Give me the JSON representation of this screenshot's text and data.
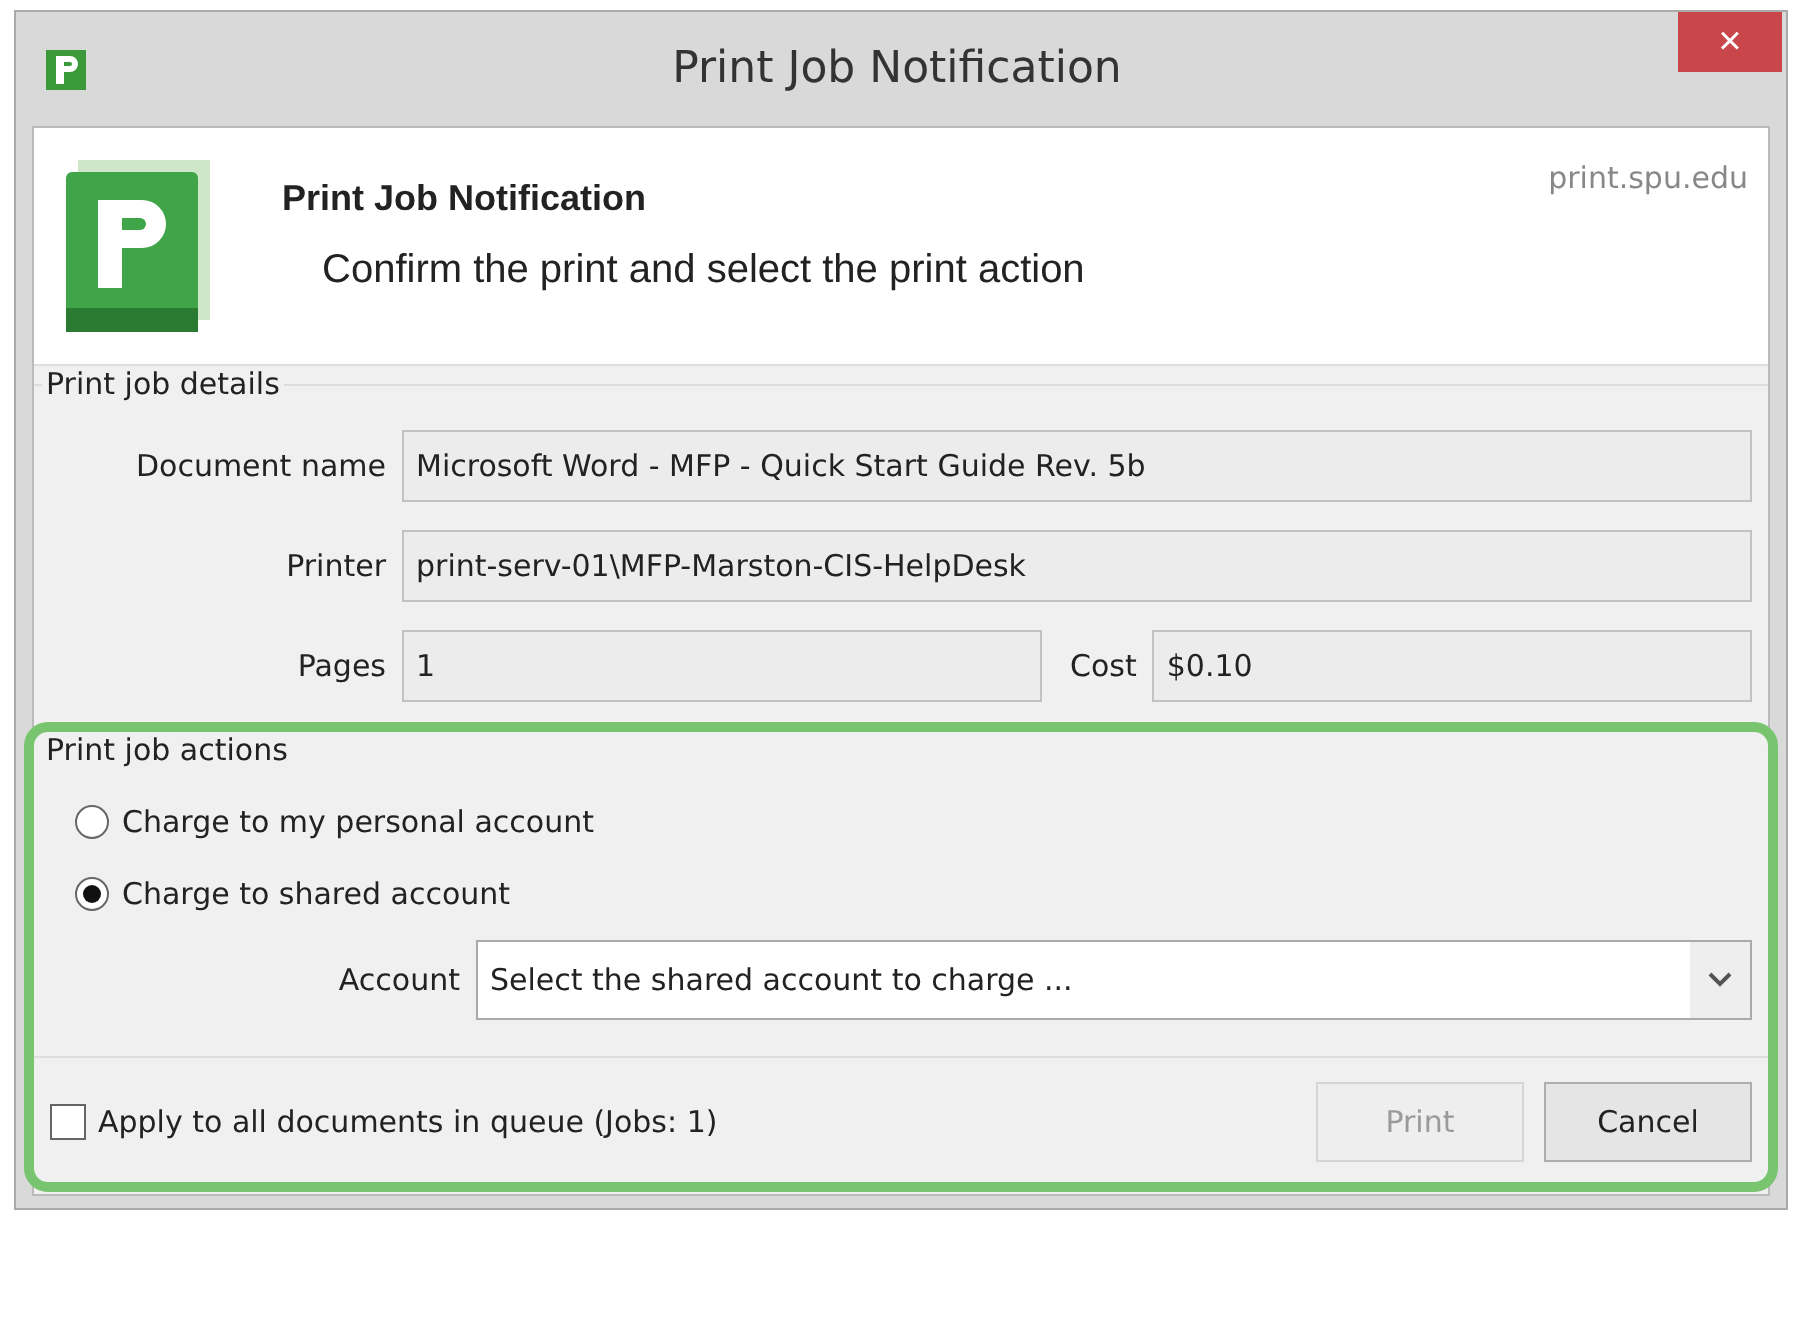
{
  "window": {
    "title": "Print Job Notification",
    "close": "×"
  },
  "header": {
    "title": "Print Job Notification",
    "subtitle": "Confirm the print and select the print action",
    "server": "print.spu.edu"
  },
  "details": {
    "legend": "Print job details",
    "fields": [
      {
        "label": "Document name",
        "value": "Microsoft Word - MFP - Quick Start Guide Rev. 5b"
      },
      {
        "label": "Printer",
        "value": "print-serv-01\\MFP-Marston-CIS-HelpDesk"
      }
    ],
    "pages": {
      "label": "Pages",
      "value": "1"
    },
    "cost": {
      "label": "Cost",
      "value": "$0.10"
    }
  },
  "actions": {
    "legend": "Print job actions",
    "options": [
      {
        "label": "Charge to my personal account",
        "selected": false
      },
      {
        "label": "Charge to shared account",
        "selected": true
      }
    ],
    "account": {
      "label": "Account",
      "placeholder": "Select the shared account to charge ..."
    }
  },
  "apply_all": {
    "label": "Apply to all documents in queue (Jobs: 1)",
    "checked": false
  },
  "buttons": [
    {
      "label": "Print",
      "disabled": true
    },
    {
      "label": "Cancel",
      "disabled": false
    }
  ]
}
